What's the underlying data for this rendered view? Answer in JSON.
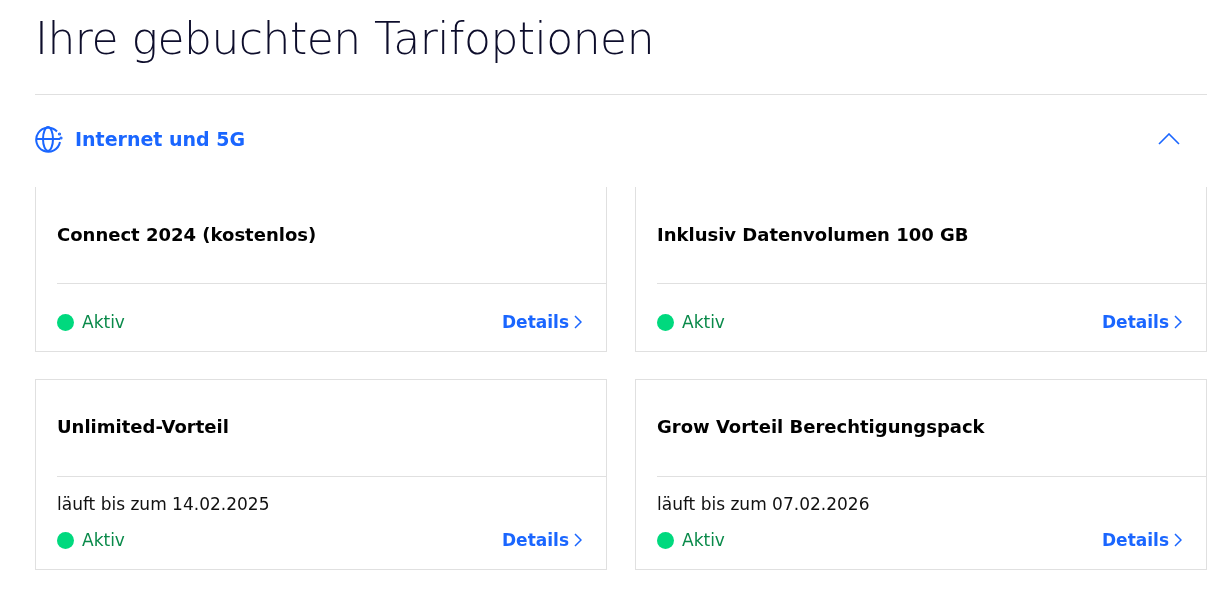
{
  "title": "Ihre gebuchten Tarifoptionen",
  "section": {
    "label": "Internet und 5G",
    "expanded": true,
    "options": [
      {
        "name": "Connect 2024 (kostenlos)",
        "status": {
          "label": "Aktiv",
          "color": "#00d97e"
        },
        "link": "Details"
      },
      {
        "name": "Inklusiv Datenvolumen 100 GB",
        "status": {
          "label": "Aktiv",
          "color": "#00d97e"
        },
        "link": "Details"
      },
      {
        "name": "Unlimited-Vorteil",
        "validity": "läuft bis zum 14.02.2025",
        "status": {
          "label": "Aktiv",
          "color": "#00d97e"
        },
        "link": "Details"
      },
      {
        "name": "Grow Vorteil Berechtigungspack",
        "validity": "läuft bis zum 07.02.2026",
        "status": {
          "label": "Aktiv",
          "color": "#00d97e"
        },
        "link": "Details"
      }
    ]
  }
}
